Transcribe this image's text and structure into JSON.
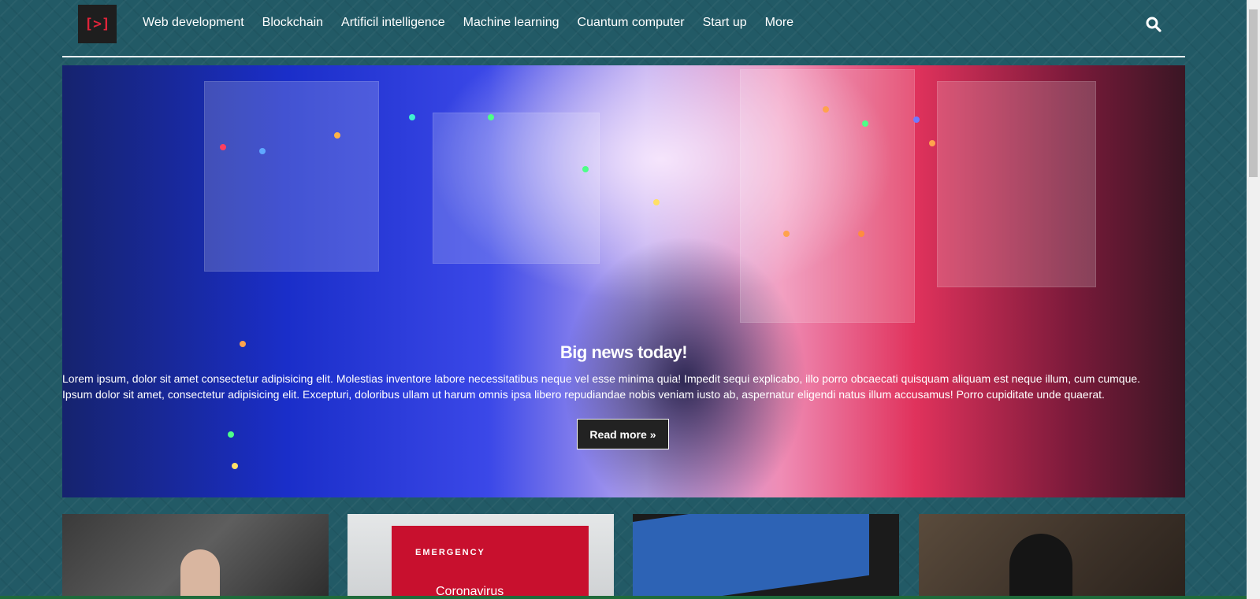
{
  "logo": {
    "text": "[>]"
  },
  "nav": {
    "items": [
      "Web development",
      "Blockchain",
      "Artificil intelligence",
      "Machine learning",
      "Cuantum computer",
      "Start up",
      "More"
    ],
    "search_icon": "search-icon"
  },
  "hero": {
    "title": "Big news today!",
    "text": "Lorem ipsum, dolor sit amet consectetur adipisicing elit. Molestias inventore labore necessitatibus neque vel esse minima quia! Impedit sequi explicabo, illo porro obcaecati quisquam aliquam est neque illum, cum cumque. Ipsum dolor sit amet, consectetur adipisicing elit. Excepturi, doloribus ullam ut harum omnis ipsa libero repudiandae nobis veniam iusto ab, aspernatur eligendi natus illum accusamus! Porro cupiditate unde quaerat.",
    "button_label": "Read more"
  },
  "cards": {
    "card2_label": "EMERGENCY",
    "card2_sub": "Coronavirus"
  },
  "colors": {
    "background": "#225a66",
    "logo_accent": "#e0243a",
    "button_bg": "#222222"
  }
}
